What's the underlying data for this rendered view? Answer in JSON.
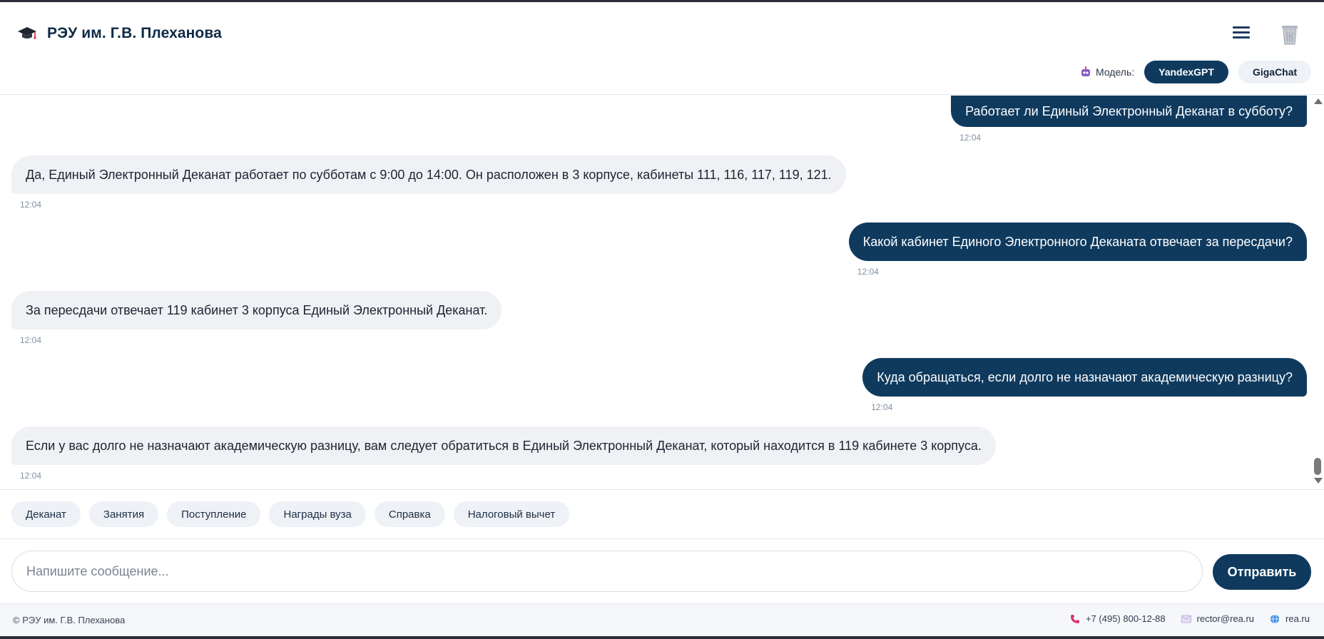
{
  "header": {
    "title": "РЭУ им. Г.В. Плеханова",
    "logo_icon": "graduation-cap-icon",
    "menu_icon": "hamburger-menu-icon",
    "clear_icon": "trash-bin-icon"
  },
  "model_selector": {
    "label": "Модель:",
    "options": [
      "YandexGPT",
      "GigaChat"
    ],
    "selected": "YandexGPT"
  },
  "messages": [
    {
      "role": "user",
      "text": "Работает ли Единый Электронный Деканат в субботу?",
      "time": "12:04"
    },
    {
      "role": "bot",
      "text": "Да, Единый Электронный Деканат работает по субботам с 9:00 до 14:00. Он расположен в 3 корпусе, кабинеты 111, 116, 117, 119, 121.",
      "time": "12:04"
    },
    {
      "role": "user",
      "text": "Какой кабинет Единого Электронного Деканата отвечает за пересдачи?",
      "time": "12:04"
    },
    {
      "role": "bot",
      "text": "За пересдачи отвечает 119 кабинет 3 корпуса  Единый Электронный Деканат.",
      "time": "12:04"
    },
    {
      "role": "user",
      "text": "Куда обращаться, если долго не назначают академическую разницу?",
      "time": "12:04"
    },
    {
      "role": "bot",
      "text": "Если у вас долго не назначают академическую разницу, вам следует обратиться в Единый Электронный Деканат, который находится в 119 кабинете 3 корпуса.",
      "time": "12:04"
    }
  ],
  "quick_topics": [
    "Деканат",
    "Занятия",
    "Поступление",
    "Награды вуза",
    "Справка",
    "Налоговый вычет"
  ],
  "composer": {
    "placeholder": "Напишите сообщение...",
    "value": "",
    "send_label": "Отправить"
  },
  "footer": {
    "copyright": "© РЭУ им. Г.В. Плеханова",
    "phone": "+7 (495) 800-12-88",
    "email": "rector@rea.ru",
    "website": "rea.ru"
  },
  "colors": {
    "primary": "#0f3a5e",
    "bot_bubble": "#f0f1f5",
    "chip": "#eef1f6",
    "footer_bg": "#f5f7fb"
  }
}
